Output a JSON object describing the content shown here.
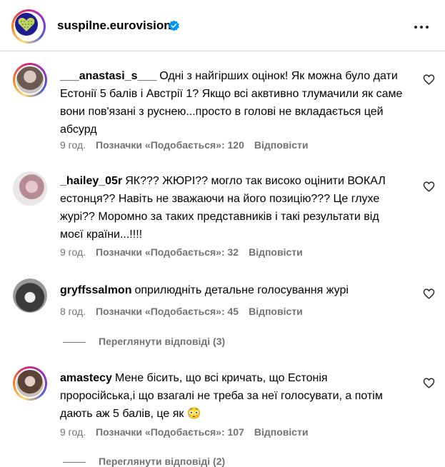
{
  "header": {
    "account_name": "suspilne.eurovision",
    "verified_icon": "verified-badge-icon",
    "more_icon": "more-options-icon"
  },
  "comments": [
    {
      "username": "___anastasi_s___",
      "text": "Одні з найгірших оцінок! Як можна було дати Естонії 5 балів і Австрії 1? Якщо всі аквтивно тлумачили як саме вони пов'язані з руснею...просто в голові не вкладається цей абсурд",
      "time": "9 год.",
      "likes": "Позначки «Подобається»: 120",
      "reply": "Відповісти"
    },
    {
      "username": "_hailey_05r",
      "text": "ЯК??? ЖЮРІ?? могло так високо оцінити ВОКАЛ естонця?? Навіть не зважаючи на його позицію??? Це глухе журі?? Моромно за таких представників і такі результати від моєї країни...!!!!",
      "time": "9 год.",
      "likes": "Позначки «Подобається»: 32",
      "reply": "Відповісти"
    },
    {
      "username": "gryffssalmon",
      "text": "оприлюдніть детальне голосування журі",
      "time": "8 год.",
      "likes": "Позначки «Подобається»: 45",
      "reply": "Відповісти",
      "view_replies": "Переглянути відповіді (3)"
    },
    {
      "username": "amastecy",
      "text": "Мене бісить, що всі кричать, що Естонія проросійська,і що взагалі не треба за неї голосувати, а потім дають аж 5 балів, це як 😳",
      "time": "9 год.",
      "likes": "Позначки «Подобається»: 107",
      "reply": "Відповісти",
      "view_replies": "Переглянути відповіді (2)"
    }
  ],
  "colors": {
    "secondary_text": "#737373",
    "verified_blue": "#0095f6",
    "logo_navy": "#1c1c8c",
    "heart_yellow": "#c8e25a"
  }
}
